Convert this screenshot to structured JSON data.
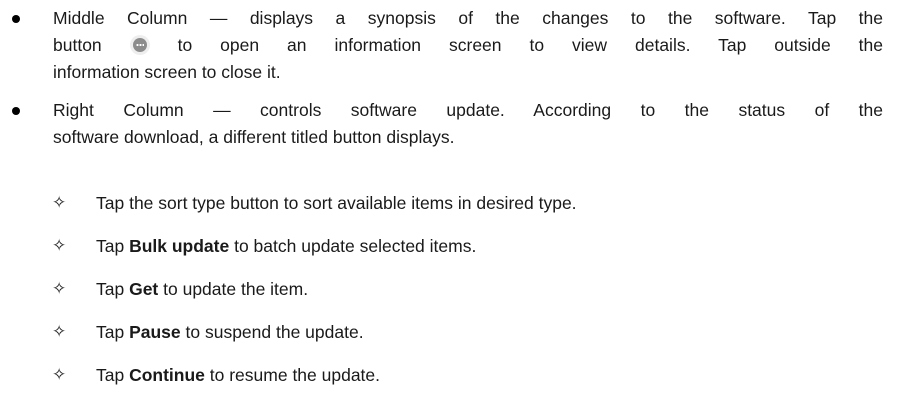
{
  "bullets": [
    {
      "lines": [
        "Middle Column — displays a synopsis of the changes to the software. Tap the",
        "to open an information screen to view details. Tap outside the",
        "information screen to close it."
      ],
      "line2_prefix": "button",
      "button_icon": "more-options-icon"
    },
    {
      "lines": [
        "Right Column — controls software update. According to the status of the",
        "software download, a different titled button displays."
      ]
    }
  ],
  "sub_marker": "✧",
  "sub_items": [
    {
      "prefix": "Tap the sort type button to sort available items in desired type.",
      "bold": "",
      "suffix": ""
    },
    {
      "prefix": "Tap ",
      "bold": "Bulk update",
      "suffix": " to batch update selected items."
    },
    {
      "prefix": "Tap ",
      "bold": "Get",
      "suffix": " to update the item."
    },
    {
      "prefix": "Tap ",
      "bold": "Pause",
      "suffix": " to suspend the update."
    },
    {
      "prefix": "Tap ",
      "bold": "Continue",
      "suffix": " to resume the update."
    }
  ]
}
